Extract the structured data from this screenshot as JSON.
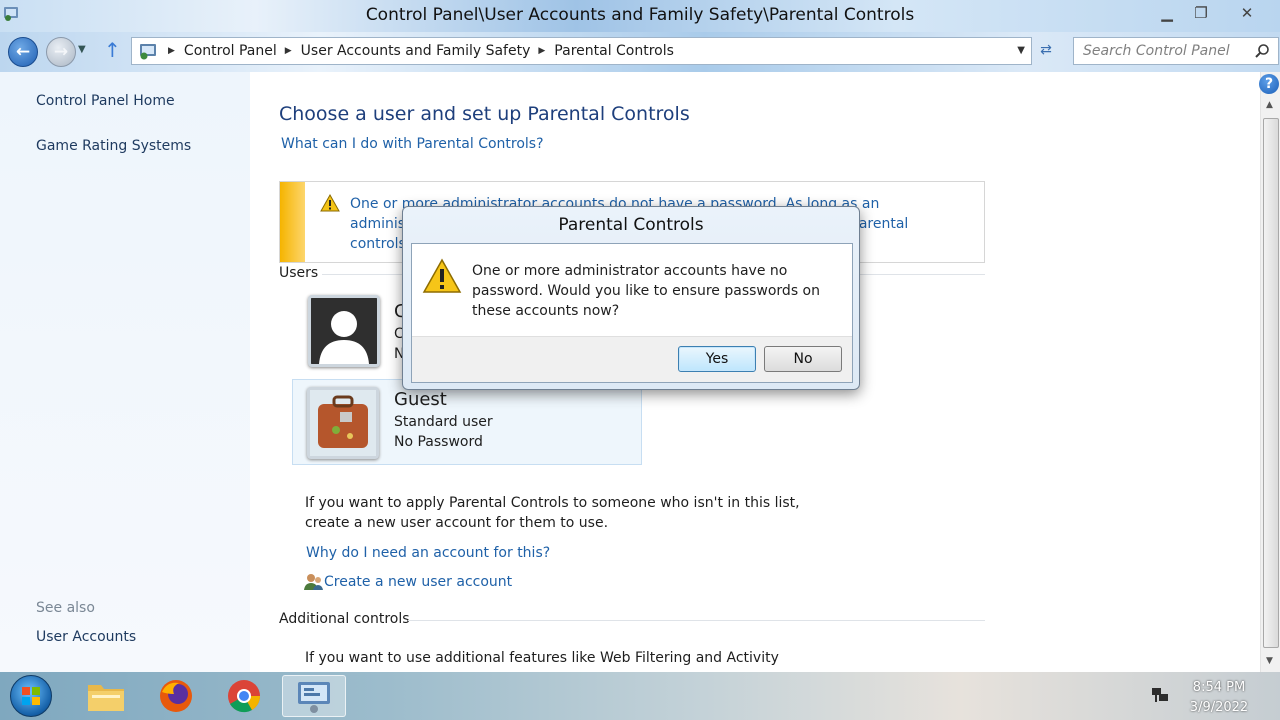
{
  "window": {
    "title": "Control Panel\\User Accounts and Family Safety\\Parental Controls",
    "buttons": {
      "minimize": "▁",
      "restore": "❐",
      "close": "✕"
    }
  },
  "navbar": {
    "breadcrumbs": [
      "Control Panel",
      "User Accounts and Family Safety",
      "Parental Controls"
    ],
    "search_placeholder": "Search Control Panel"
  },
  "sidebar": {
    "links": [
      "Control Panel Home",
      "Game Rating Systems"
    ],
    "see_also_label": "See also",
    "see_also_links": [
      "User Accounts"
    ]
  },
  "main": {
    "title": "Choose a user and set up Parental Controls",
    "help_link": "What can I do with Parental Controls?",
    "warning_text": "One or more administrator accounts do not have a password. As long as an administrator account has no password, anyone can bypass or turn off parental controls. Click here to add a password.",
    "users_label": "Users",
    "users": [
      {
        "name": "C",
        "type": "C",
        "password": "N"
      },
      {
        "name": "Guest",
        "type": "Standard user",
        "password": "No Password"
      }
    ],
    "info_line1": "If you want to apply Parental Controls to someone who isn't in this list,",
    "info_line2": "create a new user account for them to use.",
    "why_link": "Why do I need an account for this?",
    "create_link": "Create a new user account",
    "additional_label": "Additional controls",
    "additional_text": "If you want to use additional features like Web Filtering and Activity"
  },
  "dialog": {
    "title": "Parental Controls",
    "message": "One or more administrator accounts have no password. Would you like to ensure passwords on these accounts now?",
    "yes_label": "Yes",
    "no_label": "No"
  },
  "taskbar": {
    "time": "8:54 PM",
    "date": "3/9/2022",
    "apps": [
      "file-explorer-icon",
      "firefox-icon",
      "chrome-icon",
      "control-panel-icon"
    ]
  },
  "colors": {
    "link": "#1f61a8",
    "title": "#1e3f7c",
    "warning_bar": "#f5b400"
  }
}
